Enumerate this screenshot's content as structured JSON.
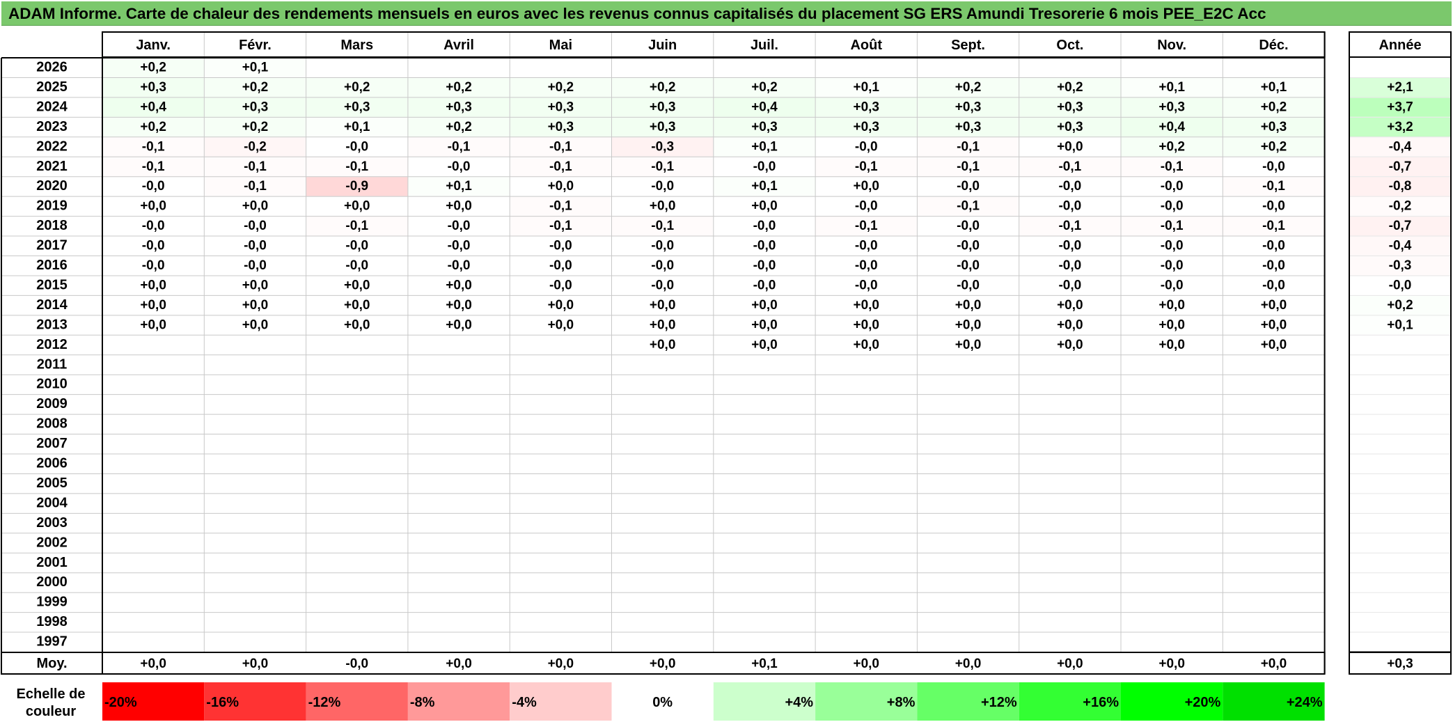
{
  "title": "ADAM Informe. Carte de chaleur des rendements mensuels en euros avec les revenus connus capitalisés du placement SG ERS Amundi Tresorerie 6 mois PEE_E2C Acc",
  "chart_data": {
    "type": "heatmap",
    "title": "ADAM Informe. Carte de chaleur des rendements mensuels en euros avec les revenus connus capitalisés du placement SG ERS Amundi Tresorerie 6 mois PEE_E2C Acc",
    "columns": [
      "Janv.",
      "Févr.",
      "Mars",
      "Avril",
      "Mai",
      "Juin",
      "Juil.",
      "Août",
      "Sept.",
      "Oct.",
      "Nov.",
      "Déc."
    ],
    "year_header": "Année",
    "rows": [
      {
        "year": "2026",
        "months": [
          "+0,2",
          "+0,1",
          "",
          "",
          "",
          "",
          "",
          "",
          "",
          "",
          "",
          ""
        ],
        "annual": ""
      },
      {
        "year": "2025",
        "months": [
          "+0,3",
          "+0,2",
          "+0,2",
          "+0,2",
          "+0,2",
          "+0,2",
          "+0,2",
          "+0,1",
          "+0,2",
          "+0,2",
          "+0,1",
          "+0,1"
        ],
        "annual": "+2,1"
      },
      {
        "year": "2024",
        "months": [
          "+0,4",
          "+0,3",
          "+0,3",
          "+0,3",
          "+0,3",
          "+0,3",
          "+0,4",
          "+0,3",
          "+0,3",
          "+0,3",
          "+0,3",
          "+0,2"
        ],
        "annual": "+3,7"
      },
      {
        "year": "2023",
        "months": [
          "+0,2",
          "+0,2",
          "+0,1",
          "+0,2",
          "+0,3",
          "+0,3",
          "+0,3",
          "+0,3",
          "+0,3",
          "+0,3",
          "+0,4",
          "+0,3"
        ],
        "annual": "+3,2"
      },
      {
        "year": "2022",
        "months": [
          "-0,1",
          "-0,2",
          "-0,0",
          "-0,1",
          "-0,1",
          "-0,3",
          "+0,1",
          "-0,0",
          "-0,1",
          "+0,0",
          "+0,2",
          "+0,2"
        ],
        "annual": "-0,4"
      },
      {
        "year": "2021",
        "months": [
          "-0,1",
          "-0,1",
          "-0,1",
          "-0,0",
          "-0,1",
          "-0,1",
          "-0,0",
          "-0,1",
          "-0,1",
          "-0,1",
          "-0,1",
          "-0,0"
        ],
        "annual": "-0,7"
      },
      {
        "year": "2020",
        "months": [
          "-0,0",
          "-0,1",
          "-0,9",
          "+0,1",
          "+0,0",
          "-0,0",
          "+0,1",
          "+0,0",
          "-0,0",
          "-0,0",
          "-0,0",
          "-0,1"
        ],
        "annual": "-0,8"
      },
      {
        "year": "2019",
        "months": [
          "+0,0",
          "+0,0",
          "+0,0",
          "+0,0",
          "-0,1",
          "+0,0",
          "+0,0",
          "-0,0",
          "-0,1",
          "-0,0",
          "-0,0",
          "-0,0"
        ],
        "annual": "-0,2"
      },
      {
        "year": "2018",
        "months": [
          "-0,0",
          "-0,0",
          "-0,1",
          "-0,0",
          "-0,1",
          "-0,1",
          "-0,0",
          "-0,1",
          "-0,0",
          "-0,1",
          "-0,1",
          "-0,1"
        ],
        "annual": "-0,7"
      },
      {
        "year": "2017",
        "months": [
          "-0,0",
          "-0,0",
          "-0,0",
          "-0,0",
          "-0,0",
          "-0,0",
          "-0,0",
          "-0,0",
          "-0,0",
          "-0,0",
          "-0,0",
          "-0,0"
        ],
        "annual": "-0,4"
      },
      {
        "year": "2016",
        "months": [
          "-0,0",
          "-0,0",
          "-0,0",
          "-0,0",
          "-0,0",
          "-0,0",
          "-0,0",
          "-0,0",
          "-0,0",
          "-0,0",
          "-0,0",
          "-0,0"
        ],
        "annual": "-0,3"
      },
      {
        "year": "2015",
        "months": [
          "+0,0",
          "+0,0",
          "+0,0",
          "+0,0",
          "-0,0",
          "-0,0",
          "-0,0",
          "-0,0",
          "-0,0",
          "-0,0",
          "-0,0",
          "-0,0"
        ],
        "annual": "-0,0"
      },
      {
        "year": "2014",
        "months": [
          "+0,0",
          "+0,0",
          "+0,0",
          "+0,0",
          "+0,0",
          "+0,0",
          "+0,0",
          "+0,0",
          "+0,0",
          "+0,0",
          "+0,0",
          "+0,0"
        ],
        "annual": "+0,2"
      },
      {
        "year": "2013",
        "months": [
          "+0,0",
          "+0,0",
          "+0,0",
          "+0,0",
          "+0,0",
          "+0,0",
          "+0,0",
          "+0,0",
          "+0,0",
          "+0,0",
          "+0,0",
          "+0,0"
        ],
        "annual": "+0,1"
      },
      {
        "year": "2012",
        "months": [
          "",
          "",
          "",
          "",
          "",
          "+0,0",
          "+0,0",
          "+0,0",
          "+0,0",
          "+0,0",
          "+0,0",
          "+0,0"
        ],
        "annual": ""
      },
      {
        "year": "2011",
        "months": [
          "",
          "",
          "",
          "",
          "",
          "",
          "",
          "",
          "",
          "",
          "",
          ""
        ],
        "annual": ""
      },
      {
        "year": "2010",
        "months": [
          "",
          "",
          "",
          "",
          "",
          "",
          "",
          "",
          "",
          "",
          "",
          ""
        ],
        "annual": ""
      },
      {
        "year": "2009",
        "months": [
          "",
          "",
          "",
          "",
          "",
          "",
          "",
          "",
          "",
          "",
          "",
          ""
        ],
        "annual": ""
      },
      {
        "year": "2008",
        "months": [
          "",
          "",
          "",
          "",
          "",
          "",
          "",
          "",
          "",
          "",
          "",
          ""
        ],
        "annual": ""
      },
      {
        "year": "2007",
        "months": [
          "",
          "",
          "",
          "",
          "",
          "",
          "",
          "",
          "",
          "",
          "",
          ""
        ],
        "annual": ""
      },
      {
        "year": "2006",
        "months": [
          "",
          "",
          "",
          "",
          "",
          "",
          "",
          "",
          "",
          "",
          "",
          ""
        ],
        "annual": ""
      },
      {
        "year": "2005",
        "months": [
          "",
          "",
          "",
          "",
          "",
          "",
          "",
          "",
          "",
          "",
          "",
          ""
        ],
        "annual": ""
      },
      {
        "year": "2004",
        "months": [
          "",
          "",
          "",
          "",
          "",
          "",
          "",
          "",
          "",
          "",
          "",
          ""
        ],
        "annual": ""
      },
      {
        "year": "2003",
        "months": [
          "",
          "",
          "",
          "",
          "",
          "",
          "",
          "",
          "",
          "",
          "",
          ""
        ],
        "annual": ""
      },
      {
        "year": "2002",
        "months": [
          "",
          "",
          "",
          "",
          "",
          "",
          "",
          "",
          "",
          "",
          "",
          ""
        ],
        "annual": ""
      },
      {
        "year": "2001",
        "months": [
          "",
          "",
          "",
          "",
          "",
          "",
          "",
          "",
          "",
          "",
          "",
          ""
        ],
        "annual": ""
      },
      {
        "year": "2000",
        "months": [
          "",
          "",
          "",
          "",
          "",
          "",
          "",
          "",
          "",
          "",
          "",
          ""
        ],
        "annual": ""
      },
      {
        "year": "1999",
        "months": [
          "",
          "",
          "",
          "",
          "",
          "",
          "",
          "",
          "",
          "",
          "",
          ""
        ],
        "annual": ""
      },
      {
        "year": "1998",
        "months": [
          "",
          "",
          "",
          "",
          "",
          "",
          "",
          "",
          "",
          "",
          "",
          ""
        ],
        "annual": ""
      },
      {
        "year": "1997",
        "months": [
          "",
          "",
          "",
          "",
          "",
          "",
          "",
          "",
          "",
          "",
          "",
          ""
        ],
        "annual": ""
      }
    ],
    "average": {
      "label": "Moy.",
      "months": [
        "+0,0",
        "+0,0",
        "-0,0",
        "+0,0",
        "+0,0",
        "+0,0",
        "+0,1",
        "+0,0",
        "+0,0",
        "+0,0",
        "+0,0",
        "+0,0"
      ],
      "annual": "+0,3"
    },
    "color_scale": {
      "label": "Echelle de couleur",
      "steps": [
        {
          "label": "-20%",
          "color": "#ff0000"
        },
        {
          "label": "-16%",
          "color": "#ff3333"
        },
        {
          "label": "-12%",
          "color": "#ff6666"
        },
        {
          "label": "-8%",
          "color": "#ff9999"
        },
        {
          "label": "-4%",
          "color": "#ffcccc"
        },
        {
          "label": "0%",
          "color": "#ffffff"
        },
        {
          "label": "+4%",
          "color": "#ccffcc"
        },
        {
          "label": "+8%",
          "color": "#99ff99"
        },
        {
          "label": "+12%",
          "color": "#66ff66"
        },
        {
          "label": "+16%",
          "color": "#33ff33"
        },
        {
          "label": "+20%",
          "color": "#00ff00"
        },
        {
          "label": "+24%",
          "color": "#00e000"
        }
      ]
    },
    "colors": {
      "title_bg": "#7bc86c",
      "positive": "#00ff00",
      "negative": "#ff0000",
      "neutral": "#ffffff"
    }
  }
}
